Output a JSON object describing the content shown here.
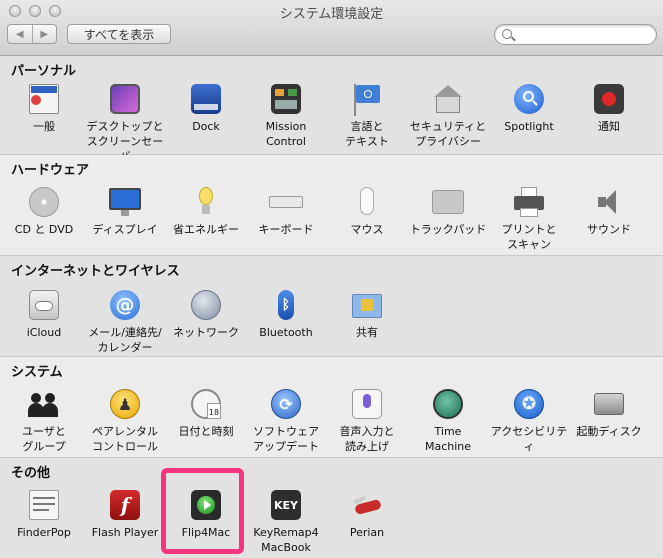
{
  "window": {
    "title": "システム環境設定"
  },
  "toolbar": {
    "back": "◀",
    "forward": "▶",
    "show_all": "すべてを表示",
    "search_value": ""
  },
  "sections": [
    {
      "title": "パーソナル",
      "items": [
        {
          "label": "一般"
        },
        {
          "label": "デスクトップと\nスクリーンセーバ"
        },
        {
          "label": "Dock"
        },
        {
          "label": "Mission\nControl"
        },
        {
          "label": "言語と\nテキスト"
        },
        {
          "label": "セキュリティと\nプライバシー"
        },
        {
          "label": "Spotlight"
        },
        {
          "label": "通知"
        }
      ]
    },
    {
      "title": "ハードウェア",
      "items": [
        {
          "label": "CD と DVD"
        },
        {
          "label": "ディスプレイ"
        },
        {
          "label": "省エネルギー"
        },
        {
          "label": "キーボード"
        },
        {
          "label": "マウス"
        },
        {
          "label": "トラックパッド"
        },
        {
          "label": "プリントと\nスキャン"
        },
        {
          "label": "サウンド"
        }
      ]
    },
    {
      "title": "インターネットとワイヤレス",
      "items": [
        {
          "label": "iCloud"
        },
        {
          "label": "メール/連絡先/\nカレンダー"
        },
        {
          "label": "ネットワーク"
        },
        {
          "label": "Bluetooth"
        },
        {
          "label": "共有"
        }
      ]
    },
    {
      "title": "システム",
      "items": [
        {
          "label": "ユーザと\nグループ"
        },
        {
          "label": "ペアレンタル\nコントロール"
        },
        {
          "label": "日付と時刻"
        },
        {
          "label": "ソフトウェア\nアップデート"
        },
        {
          "label": "音声入力と\n読み上げ"
        },
        {
          "label": "Time\nMachine"
        },
        {
          "label": "アクセシビリティ"
        },
        {
          "label": "起動ディスク"
        }
      ]
    },
    {
      "title": "その他",
      "items": [
        {
          "label": "FinderPop"
        },
        {
          "label": "Flash Player"
        },
        {
          "label": "Flip4Mac"
        },
        {
          "label": "KeyRemap4\nMacBook"
        },
        {
          "label": "Perian"
        }
      ]
    }
  ],
  "icon_text": {
    "key_badge": "KEY",
    "calendar_day": "18"
  },
  "colors": {
    "highlight": "#f5357e",
    "accent_blue": "#2a6fd6"
  }
}
